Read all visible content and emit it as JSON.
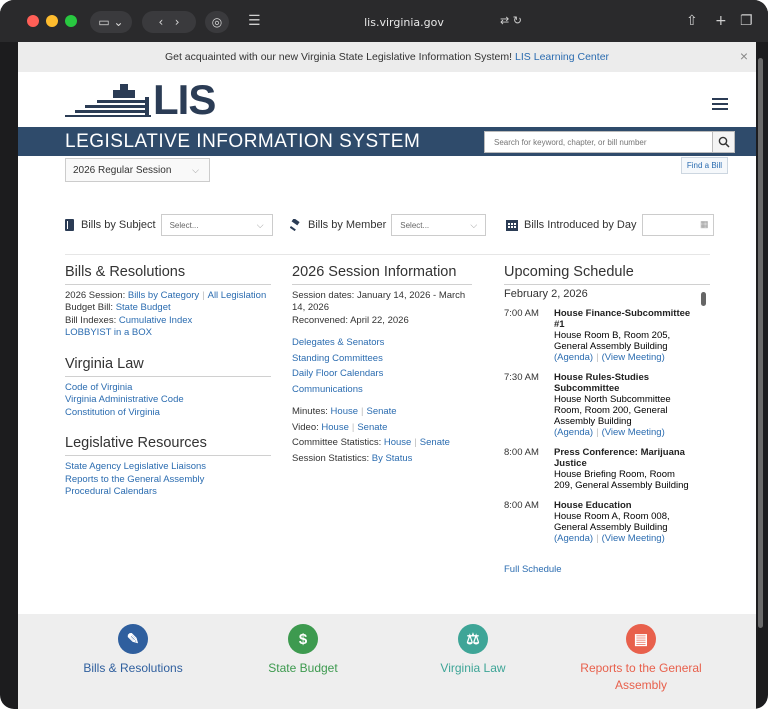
{
  "browser": {
    "url": "lis.virginia.gov"
  },
  "banner": {
    "text": "Get acquainted with our new Virginia State Legislative Information System!",
    "link": "LIS Learning Center"
  },
  "header": {
    "logo_text": "LIS",
    "title": "LEGISLATIVE INFORMATION SYSTEM",
    "search_placeholder": "Search for keyword, chapter, or bill number"
  },
  "session": {
    "selected": "2026 Regular Session",
    "find_bill": "Find a Bill"
  },
  "filters": {
    "subject": {
      "label": "Bills by Subject",
      "value": "Select..."
    },
    "member": {
      "label": "Bills by Member",
      "value": "Select..."
    },
    "introduced": {
      "label": "Bills Introduced by Day"
    }
  },
  "bills": {
    "title": "Bills & Resolutions",
    "session_label": "2026 Session:",
    "by_category": "Bills by Category",
    "all_legislation": "All Legislation",
    "budget_label": "Budget Bill:",
    "state_budget": "State Budget",
    "indexes_label": "Bill Indexes:",
    "cumulative_index": "Cumulative Index",
    "lobbyist": "LOBBYIST in a BOX"
  },
  "law": {
    "title": "Virginia Law",
    "items": [
      "Code of Virginia",
      "Virginia Administrative Code",
      "Constitution of Virginia"
    ]
  },
  "resources": {
    "title": "Legislative Resources",
    "items": [
      "State Agency Legislative Liaisons",
      "Reports to the General Assembly",
      "Procedural Calendars"
    ]
  },
  "session_info": {
    "title": "2026 Session Information",
    "dates": "Session dates: January 14, 2026 - March 14, 2026",
    "reconvened": "Reconvened: April 22, 2026",
    "links": [
      "Delegates & Senators",
      "Standing Committees",
      "Daily Floor Calendars",
      "Communications"
    ],
    "minutes_label": "Minutes:",
    "video_label": "Video:",
    "committee_label": "Committee Statistics:",
    "stats_label": "Session Statistics:",
    "house": "House",
    "senate": "Senate",
    "by_status": "By Status"
  },
  "schedule": {
    "title": "Upcoming Schedule",
    "date": "February 2, 2026",
    "agenda": "(Agenda)",
    "view_meeting": "(View Meeting)",
    "events": [
      {
        "time": "7:00 AM",
        "name": "House Finance-Subcommittee #1",
        "location": "House Room B, Room 205, General Assembly Building"
      },
      {
        "time": "7:30 AM",
        "name": "House Rules-Studies Subcommittee",
        "location": "House North Subcommittee Room, Room 200, General Assembly Building"
      },
      {
        "time": "8:00 AM",
        "name": "Press Conference: Marijuana Justice",
        "location": "House Briefing Room, Room 209, General Assembly Building"
      },
      {
        "time": "8:00 AM",
        "name": "House Education",
        "location": "House Room A, Room 008, General Assembly Building"
      }
    ],
    "full": "Full Schedule"
  },
  "footer": {
    "items": [
      {
        "label": "Bills & Resolutions",
        "color": "#2f5f9e"
      },
      {
        "label": "State Budget",
        "color": "#3d9a4f"
      },
      {
        "label": "Virginia Law",
        "color": "#3ea597"
      },
      {
        "label": "Reports to the General Assembly",
        "color": "#e8604c"
      }
    ]
  }
}
